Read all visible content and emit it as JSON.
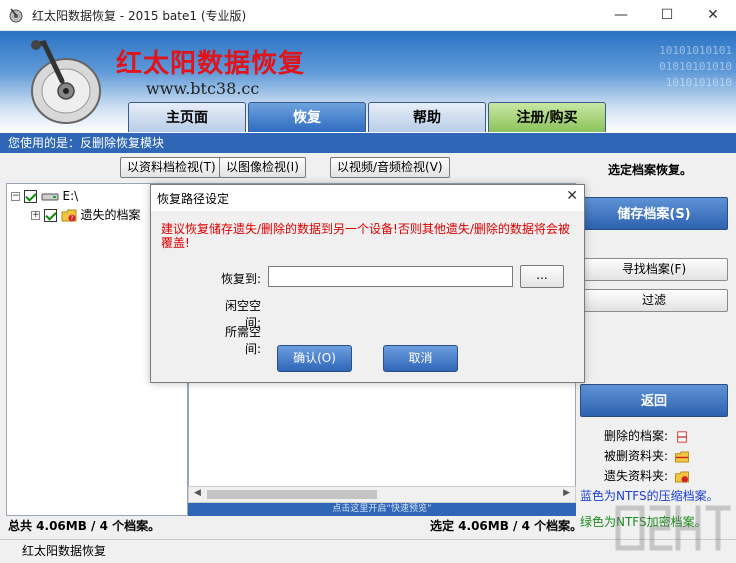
{
  "window": {
    "title": "红太阳数据恢复 - 2015 bate1 (专业版)",
    "minimize": "—",
    "maximize": "☐",
    "close": "✕"
  },
  "banner": {
    "brand": "红太阳数据恢复",
    "url": "www.btc38.cc",
    "binary_lines": [
      "10101010101",
      "01010101010",
      "1010101010"
    ]
  },
  "tabs": [
    {
      "label": "主页面"
    },
    {
      "label": "恢复"
    },
    {
      "label": "帮助"
    },
    {
      "label": "注册/购买"
    }
  ],
  "info": "您使用的是：反删除恢复模块",
  "filters": [
    {
      "label": "以资料档检视(T)"
    },
    {
      "label": "以图像检视(I)"
    },
    {
      "label": "以视频/音频检视(V)"
    }
  ],
  "tree": {
    "drive": "E:\\",
    "lost": "遗失的档案"
  },
  "preview_hint": "点击这里开启“快速预览”",
  "right_panel": {
    "title": "选定档案恢复。",
    "save": "储存档案(S)",
    "find": "寻找档案(F)",
    "filter": "过滤",
    "back": "返回",
    "legend": [
      {
        "label": "删除的档案:"
      },
      {
        "label": "被删资料夹:"
      },
      {
        "label": "遗失资料夹:"
      }
    ],
    "blue_note": "蓝色为NTFS的压缩档案。",
    "green_note": "绿色为NTFS加密档案。"
  },
  "summary": {
    "total": "总共 4.06MB / 4 个档案。",
    "selected": "选定 4.06MB / 4 个档案。"
  },
  "statusbar": "红太阳数据恢复",
  "dialog": {
    "title": "恢复路径设定",
    "close": "✕",
    "warning": "建议恢复储存遗失/删除的数据到另一个设备!否则其他遗失/删除的数据将会被覆盖!",
    "restore_to_label": "恢复到:",
    "restore_path": "",
    "browse": "...",
    "free_space_label": "闲空空间:",
    "required_space_label": "所需空间:",
    "ok": "确认(O)",
    "cancel": "取消"
  },
  "colors": {
    "brand_red": "#e0141a",
    "accent_blue": "#2f67b6",
    "warning_red": "#dd0000",
    "ntfs_compressed_blue": "#1b3fd0",
    "ntfs_encrypted_green": "#1b8a1b"
  }
}
